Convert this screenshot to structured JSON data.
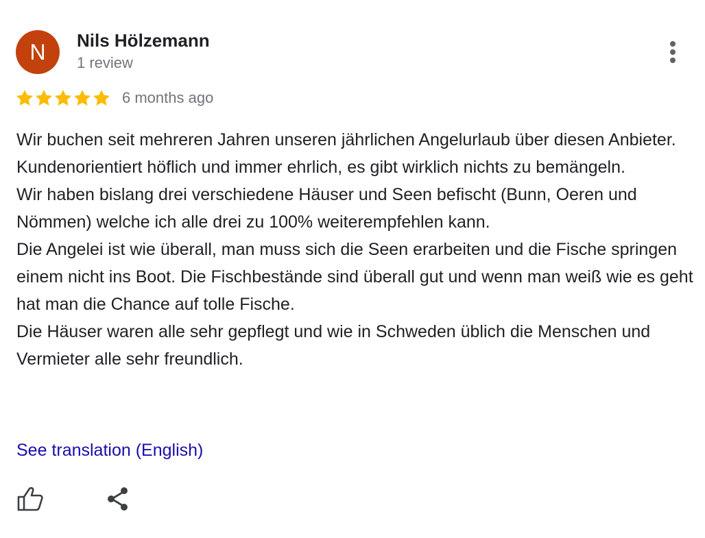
{
  "reviewer": {
    "initial": "N",
    "name": "Nils Hölzemann",
    "review_count": "1 review",
    "avatar_color": "#c2410c"
  },
  "rating": {
    "stars": 5,
    "max": 5,
    "star_color": "#fbbc04",
    "time": "6 months ago"
  },
  "review": {
    "lines": [
      "Wir buchen seit mehreren Jahren unseren jährlichen Angelurlaub über diesen Anbieter.",
      "Kundenorientiert höflich und immer ehrlich, es gibt wirklich nichts zu bemängeln.",
      "Wir haben bislang drei verschiedene Häuser und Seen befischt (Bunn, Oeren und Nömmen) welche ich alle drei zu 100% weiterempfehlen kann.",
      "Die Angelei ist wie überall, man muss sich die Seen erarbeiten und die Fische springen einem nicht ins Boot. Die Fischbestände sind überall gut und wenn man weiß wie es geht hat man die Chance auf tolle Fische.",
      "Die Häuser waren alle sehr gepflegt und wie in Schweden üblich die Menschen und Vermieter alle sehr freundlich."
    ]
  },
  "actions": {
    "translate_label": "See translation (English)",
    "icons": [
      "more-vert-icon",
      "thumbs-up-icon",
      "share-icon"
    ]
  }
}
